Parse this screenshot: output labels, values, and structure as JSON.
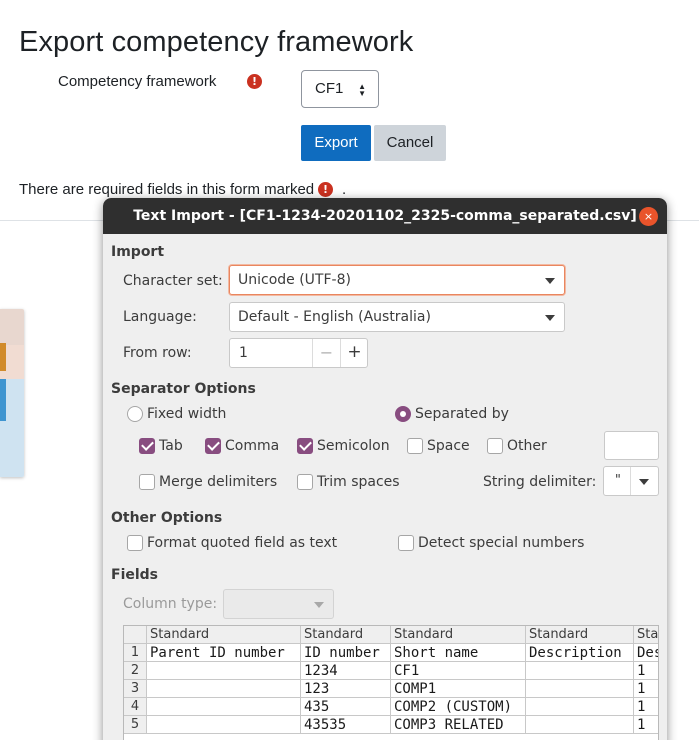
{
  "page": {
    "title": "Export competency framework",
    "framework_label": "Competency framework",
    "framework_value": "CF1",
    "export_label": "Export",
    "cancel_label": "Cancel",
    "required_note": "There are required fields in this form marked",
    "required_note_end": ".",
    "required_icon": "!"
  },
  "dialog": {
    "title": "Text Import - [CF1-1234-20201102_2325-comma_separated.csv]",
    "close_icon": "×",
    "import": {
      "heading": "Import",
      "charset_label": "Character set:",
      "charset_value": "Unicode (UTF-8)",
      "language_label": "Language:",
      "language_value": "Default - English (Australia)",
      "from_row_label": "From row:",
      "from_row_value": "1",
      "minus": "−",
      "plus": "+"
    },
    "separator": {
      "heading": "Separator Options",
      "fixed_width": "Fixed width",
      "separated_by": "Separated by",
      "tab": "Tab",
      "comma": "Comma",
      "semicolon": "Semicolon",
      "space": "Space",
      "other": "Other",
      "merge": "Merge delimiters",
      "trim": "Trim spaces",
      "string_delim_label": "String delimiter:",
      "string_delim_value": "\""
    },
    "other_options": {
      "heading": "Other Options",
      "format_quoted": "Format quoted field as text",
      "detect_special": "Detect special numbers"
    },
    "fields": {
      "heading": "Fields",
      "column_type_label": "Column type:",
      "column_headers": [
        "Standard",
        "Standard",
        "Standard",
        "Standard",
        "Standard"
      ],
      "row_numbers": [
        "1",
        "2",
        "3",
        "4",
        "5"
      ],
      "rows": [
        [
          "Parent ID number",
          "ID number",
          "Short name",
          "Description",
          "Description"
        ],
        [
          "",
          "1234",
          "CF1",
          "",
          "1"
        ],
        [
          "",
          "123",
          "COMP1",
          "",
          "1"
        ],
        [
          "",
          "435",
          "COMP2 (CUSTOM)",
          "",
          "1"
        ],
        [
          "",
          "43535",
          "COMP3 RELATED",
          "",
          "1"
        ]
      ]
    }
  }
}
